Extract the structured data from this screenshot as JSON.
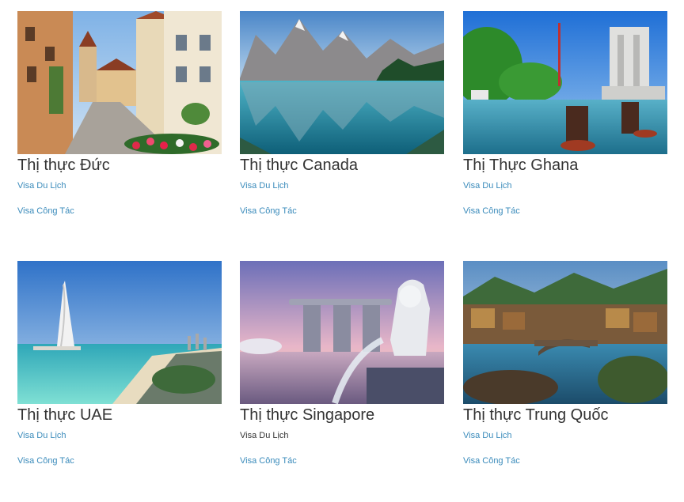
{
  "cards": [
    {
      "title": "Thị thực Đức",
      "links": [
        "Visa Du Lịch",
        "Visa Công Tác"
      ]
    },
    {
      "title": "Thị thực Canada",
      "links": [
        "Visa Du Lịch",
        "Visa Công Tác"
      ]
    },
    {
      "title": "Thị Thực Ghana",
      "links": [
        "Visa Du Lịch",
        "Visa Công Tác"
      ]
    },
    {
      "title": "Thị thực UAE",
      "links": [
        "Visa Du Lịch",
        "Visa Công Tác"
      ]
    },
    {
      "title": "Thị thực Singapore",
      "links": [
        "Visa Du Lịch",
        "Visa Công Tác"
      ]
    },
    {
      "title": "Thị thực Trung Quốc",
      "links": [
        "Visa Du Lịch",
        "Visa Công Tác"
      ]
    }
  ],
  "colors": {
    "link": "#3a8bbb",
    "title": "#333333",
    "link_hovered": "#333333"
  }
}
